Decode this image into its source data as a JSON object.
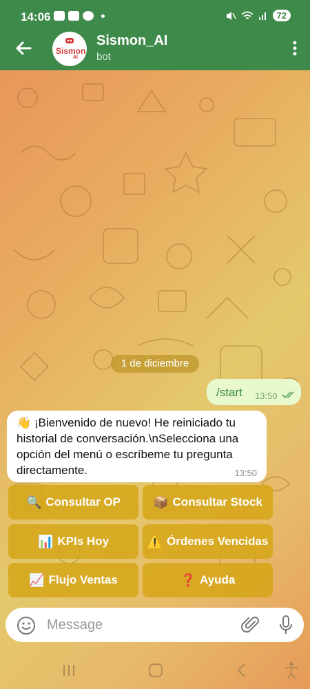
{
  "status_bar": {
    "time": "14:06",
    "battery": "72"
  },
  "header": {
    "title": "Sismon_AI",
    "subtitle": "bot",
    "avatar_text": "Sismon",
    "avatar_sub": "AI"
  },
  "chat": {
    "date_chip": "1 de diciembre",
    "outgoing": {
      "text": "/start",
      "time": "13:50"
    },
    "incoming": {
      "text": "👋 ¡Bienvenido de nuevo! He reiniciado tu historial de conversación.\\nSelecciona una opción del menú o escríbeme tu pregunta directamente.",
      "time": "13:50"
    }
  },
  "keyboard": [
    {
      "emoji": "🔍",
      "label": "Consultar OP"
    },
    {
      "emoji": "📦",
      "label": "Consultar Stock"
    },
    {
      "emoji": "📊",
      "label": "KPIs Hoy"
    },
    {
      "emoji": "⚠️",
      "label": "Órdenes Vencidas"
    },
    {
      "emoji": "📈",
      "label": "Flujo Ventas"
    },
    {
      "emoji": "❓",
      "label": "Ayuda"
    }
  ],
  "input": {
    "placeholder": "Message"
  },
  "colors": {
    "header": "#3e8a4a",
    "button": "#d6a618",
    "outgoing_bubble": "#e8f8cf"
  }
}
